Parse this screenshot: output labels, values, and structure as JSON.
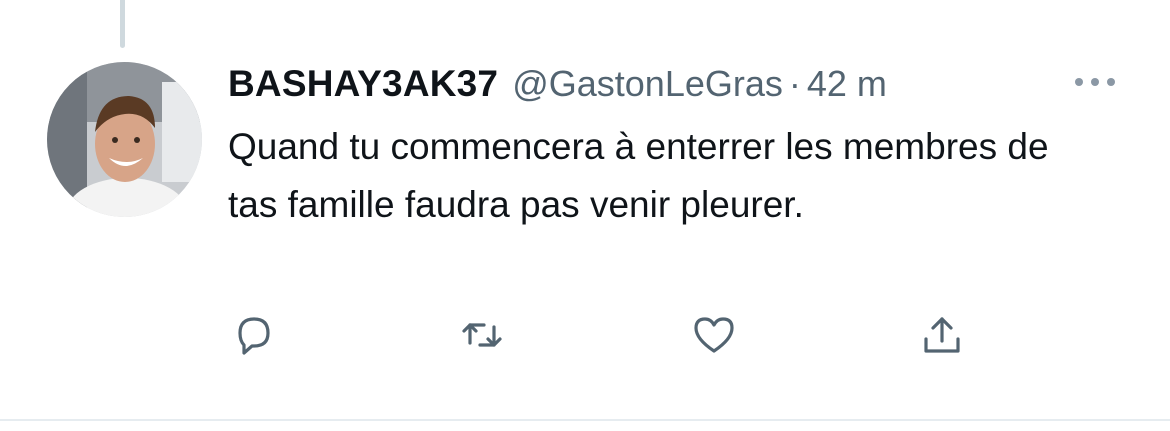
{
  "tweet": {
    "display_name": "BASHAY3AK37",
    "handle": "@GastonLeGras",
    "separator": "·",
    "time": "42 m",
    "text": "Quand tu commencera à enterrer les membres de tas famille faudra pas venir pleurer."
  },
  "icons": {
    "more": "more-horizontal-icon",
    "reply": "reply-bubble-icon",
    "retweet": "retweet-icon",
    "like": "heart-icon",
    "share": "share-icon"
  },
  "colors": {
    "text_primary": "#0f1419",
    "text_secondary": "#536471",
    "thread_line": "#cfd9de",
    "border": "#e6ecf0"
  }
}
